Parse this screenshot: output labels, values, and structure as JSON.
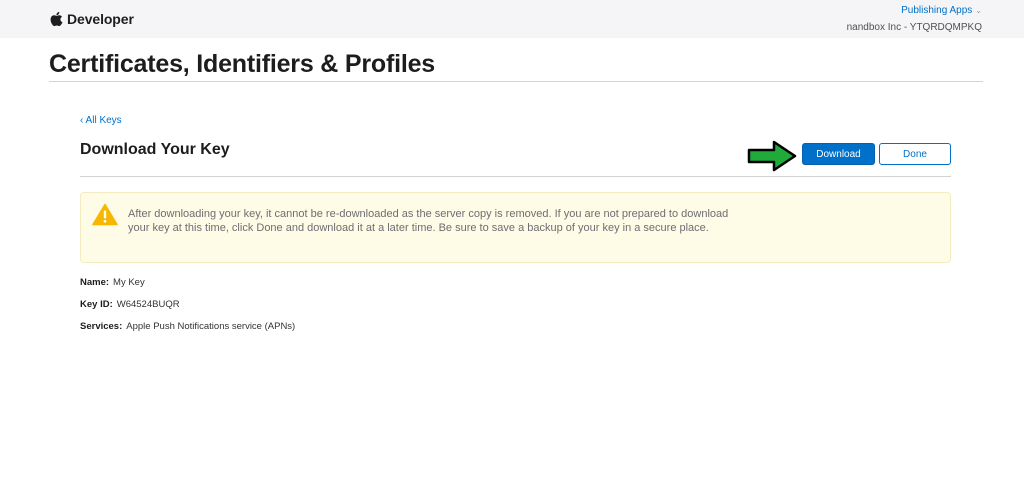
{
  "header": {
    "brand": "Developer",
    "team_menu_label": "Publishing Apps",
    "team_id": "nandbox Inc - YTQRDQMPKQ"
  },
  "page_title": "Certificates, Identifiers & Profiles",
  "back_link": "‹ All Keys",
  "section_title": "Download Your Key",
  "actions": {
    "download_label": "Download",
    "done_label": "Done"
  },
  "warning": {
    "text": "After downloading your key, it cannot be re-downloaded as the server copy is removed. If you are not prepared to download your key at this time, click Done and download it at a later time. Be sure to save a backup of your key in a secure place."
  },
  "details": {
    "name_label": "Name:",
    "name_value": "My Key",
    "key_id_label": "Key ID:",
    "key_id_value": "W64524BUQR",
    "services_label": "Services:",
    "services_value": "Apple Push Notifications service (APNs)"
  },
  "colors": {
    "accent": "#0070c9",
    "warning_bg": "#fefbe6",
    "warning_icon": "#f5b700",
    "annotation_arrow": "#1faa3a"
  },
  "icons": [
    "apple-logo-icon",
    "chevron-down-icon",
    "warning-icon",
    "green-arrow-annotation"
  ]
}
